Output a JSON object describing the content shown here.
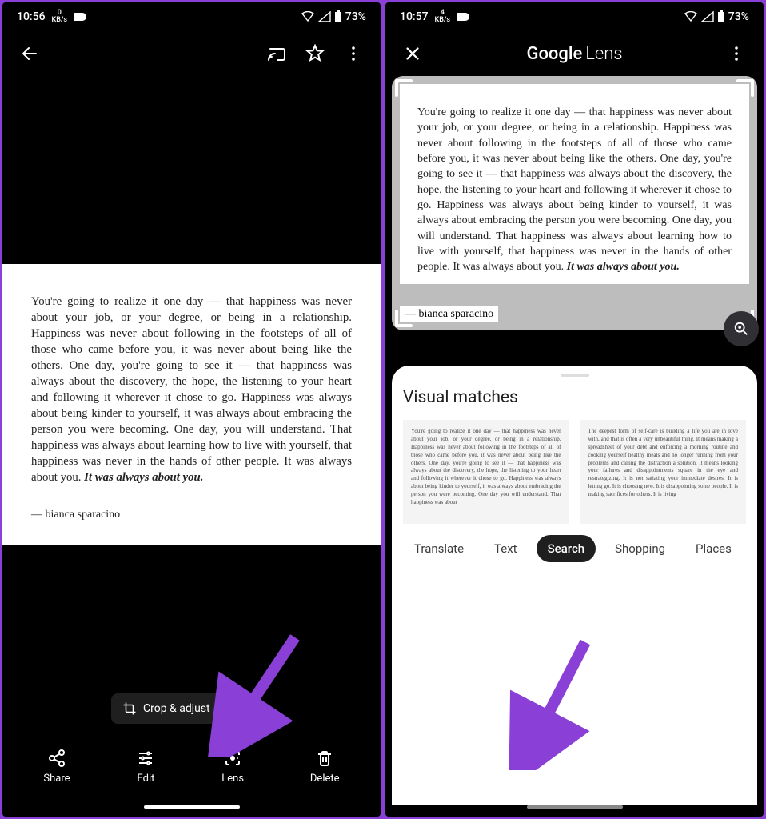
{
  "left": {
    "status": {
      "time": "10:56",
      "speed_val": "0",
      "speed_unit": "KB/s",
      "battery": "73%"
    },
    "quote_text": "You're going to realize it one day — that happiness was never about your job, or your degree, or being in a relationship. Happiness was never about following in the footsteps of all of those who came before you, it was never about being like the others. One day, you're going to see it — that happiness was always about the discovery, the hope, the listening to your heart and following it wherever it chose to go. Happiness was always about being kinder to yourself, it was always about embracing the person you were becoming. One day, you will understand. That happiness was always about learning how to live with yourself, that happiness was never in the hands of other people. It was always about you. ",
    "quote_emph": "It was always about you.",
    "quote_author": "— bianca sparacino",
    "crop_tooltip": "Crop & adjust",
    "bottom": {
      "share": "Share",
      "edit": "Edit",
      "lens": "Lens",
      "delete": "Delete"
    }
  },
  "right": {
    "status": {
      "time": "10:57",
      "speed_val": "4",
      "speed_unit": "KB/s",
      "battery": "73%"
    },
    "title_google": "Google",
    "title_lens": "Lens",
    "quote_text": "You're going to realize it one day — that happiness was never about your job, or your degree, or being in a relationship. Happiness was never about following in the footsteps of all of those who came before you, it was never about being like the others. One day, you're going to see it — that happiness was always about the discovery, the hope, the listening to your heart and following it wherever it chose to go. Happiness was always about being kinder to yourself, it was always about embracing the person you were becoming. One day, you will understand. That happiness was always about learning how to live with yourself, that happiness was never in the hands of other people. It was always about you. ",
    "quote_emph": "It was always about you.",
    "quote_author": "— bianca sparacino",
    "sheet_title": "Visual matches",
    "match1": "You're going to realize it one day — that happiness was never about your job, or your degree, or being in a relationship. Happiness was never about following in the footsteps of all of those who came before you, it was never about being like the others. One day, you're going to see it — that happiness was always about the discovery, the hope, the listening to your heart and following it wherever it chose to go. Happiness was always about being kinder to yourself, it was always about embracing the person you were becoming. One day you will understand. That happiness was about",
    "match2": "The deepest form of self-care is building a life you are in love with, and that is often a very unbeautiful thing. It means making a spreadsheet of your debt and enforcing a morning routine and cooking yourself healthy meals and no longer running from your problems and calling the distraction a solution. It means looking your failures and disappointments square in the eye and restrategizing. It is not satiating your immediate desires. It is letting go. It is choosing new. It is disappointing some people. It is making sacrifices for others. It is living",
    "tabs": {
      "translate": "Translate",
      "text": "Text",
      "search": "Search",
      "shopping": "Shopping",
      "places": "Places"
    }
  },
  "annotation_color": "#8a3fd6"
}
